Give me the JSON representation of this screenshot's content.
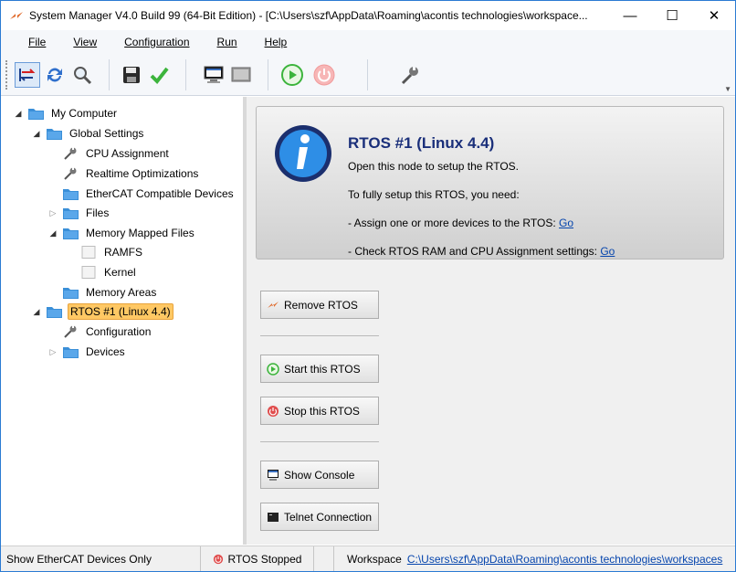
{
  "window": {
    "title": "System Manager V4.0 Build 99 (64-Bit Edition) - [C:\\Users\\szf\\AppData\\Roaming\\acontis technologies\\workspace...",
    "minimize": "—",
    "maximize": "☐",
    "close": "✕"
  },
  "menu": {
    "file": "File",
    "view": "View",
    "configuration": "Configuration",
    "run": "Run",
    "help": "Help"
  },
  "tree": {
    "my_computer": "My Computer",
    "global_settings": "Global Settings",
    "cpu_assignment": "CPU Assignment",
    "realtime_optimizations": "Realtime Optimizations",
    "ethercat_devices": "EtherCAT Compatible Devices",
    "files": "Files",
    "memory_mapped_files": "Memory Mapped Files",
    "ramfs": "RAMFS",
    "kernel": "Kernel",
    "memory_areas": "Memory Areas",
    "rtos": "RTOS #1 (Linux 4.4)",
    "configuration": "Configuration",
    "devices": "Devices"
  },
  "info": {
    "title": "RTOS #1 (Linux 4.4)",
    "line1": "Open this node to setup the RTOS.",
    "line2": "To fully setup this RTOS, you need:",
    "line3": "- Assign one or more devices to the RTOS:",
    "line4": "- Check RTOS RAM and CPU Assignment settings:",
    "go": "Go"
  },
  "actions": {
    "remove": "Remove RTOS",
    "start": "Start this RTOS",
    "stop": "Stop this RTOS",
    "console": "Show Console",
    "telnet": "Telnet Connection"
  },
  "status": {
    "ethercat_only": "Show EtherCAT Devices Only",
    "rtos_state": "RTOS Stopped",
    "workspace_label": "Workspace",
    "workspace_path": "C:\\Users\\szf\\AppData\\Roaming\\acontis technologies\\workspaces"
  },
  "colors": {
    "accent": "#2b7bd3",
    "selection": "#ffc864",
    "folder": "#3a8fd8",
    "start_green": "#3cb43c",
    "stop_red": "#e04c4c"
  }
}
